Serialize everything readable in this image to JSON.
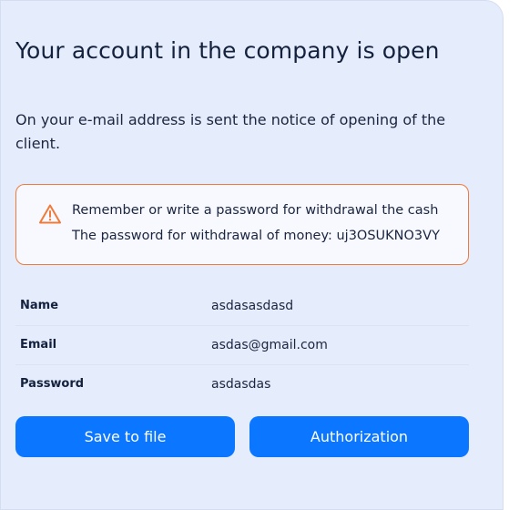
{
  "page": {
    "title": "Your account in the company is open",
    "notice": "On your e-mail address is sent the notice of opening of the client."
  },
  "alert": {
    "icon": "warning-triangle-icon",
    "accent_color": "#f07a3a",
    "line1": "Remember or write a password for withdrawal the cash",
    "line2": "The password for withdrawal of money: uj3OSUKNO3VY"
  },
  "account": {
    "rows": [
      {
        "label": "Name",
        "value": "asdasasdasd"
      },
      {
        "label": "Email",
        "value": "asdas@gmail.com"
      },
      {
        "label": "Password",
        "value": "asdasdas"
      }
    ]
  },
  "actions": {
    "save_label": "Save to file",
    "auth_label": "Authorization",
    "button_color": "#0b76ff"
  }
}
